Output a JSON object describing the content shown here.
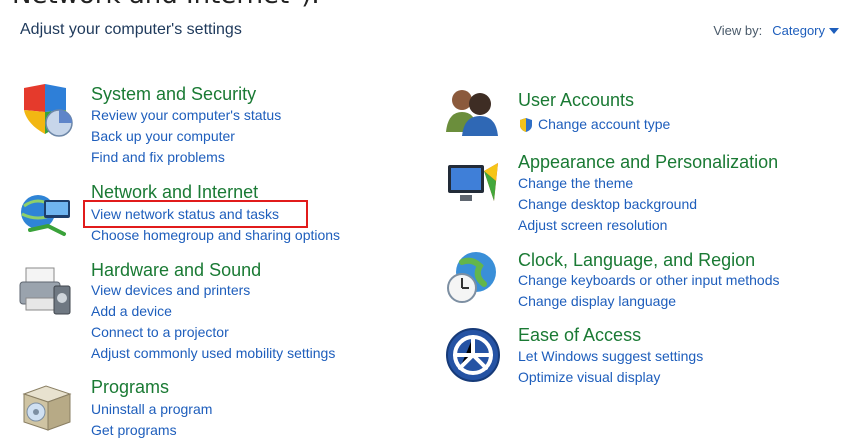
{
  "caption_partial": "Network and Internet\").",
  "header": {
    "title": "Adjust your computer's settings",
    "view_by_label": "View by:",
    "view_by_value": "Category"
  },
  "left": [
    {
      "key": "system",
      "heading": "System and Security",
      "links": [
        "Review your computer's status",
        "Back up your computer",
        "Find and fix problems"
      ],
      "icon": "shield-icon"
    },
    {
      "key": "network",
      "heading": "Network and Internet",
      "links": [
        "View network status and tasks",
        "Choose homegroup and sharing options"
      ],
      "icon": "network-globe-icon"
    },
    {
      "key": "hardware",
      "heading": "Hardware and Sound",
      "links": [
        "View devices and printers",
        "Add a device",
        "Connect to a projector",
        "Adjust commonly used mobility settings"
      ],
      "icon": "printer-icon"
    },
    {
      "key": "programs",
      "heading": "Programs",
      "links": [
        "Uninstall a program",
        "Get programs"
      ],
      "icon": "programs-box-icon"
    }
  ],
  "right": [
    {
      "key": "users",
      "heading": "User Accounts",
      "links": [
        "Change account type"
      ],
      "icon": "users-icon"
    },
    {
      "key": "appearance",
      "heading": "Appearance and Personalization",
      "links": [
        "Change the theme",
        "Change desktop background",
        "Adjust screen resolution"
      ],
      "icon": "monitor-paint-icon"
    },
    {
      "key": "clock",
      "heading": "Clock, Language, and Region",
      "links": [
        "Change keyboards or other input methods",
        "Change display language"
      ],
      "icon": "globe-clock-icon"
    },
    {
      "key": "ease",
      "heading": "Ease of Access",
      "links": [
        "Let Windows suggest settings",
        "Optimize visual display"
      ],
      "icon": "ease-of-access-icon"
    }
  ],
  "colors": {
    "heading_green": "#1a7a34",
    "link_blue": "#1e5ebc",
    "highlight_red": "#e11b1b"
  }
}
